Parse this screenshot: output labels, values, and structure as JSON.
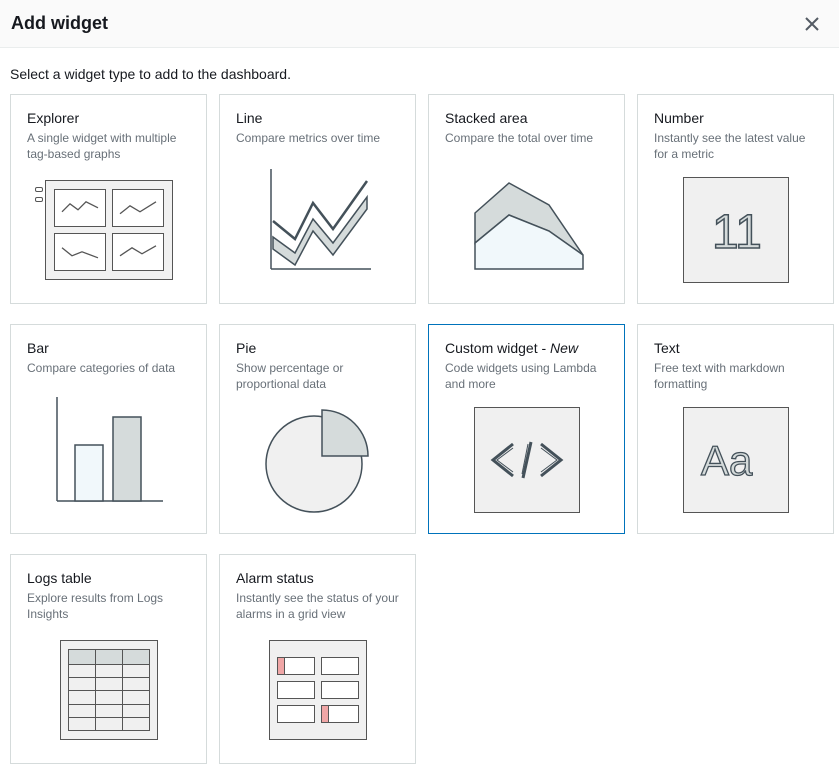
{
  "dialog": {
    "title": "Add widget",
    "subtitle": "Select a widget type to add to the dashboard."
  },
  "widgets": {
    "explorer": {
      "title": "Explorer",
      "desc": "A single widget with multiple tag-based graphs"
    },
    "line": {
      "title": "Line",
      "desc": "Compare metrics over time"
    },
    "stacked": {
      "title": "Stacked area",
      "desc": "Compare the total over time"
    },
    "number": {
      "title": "Number",
      "desc": "Instantly see the latest value for a metric",
      "value": "11"
    },
    "bar": {
      "title": "Bar",
      "desc": "Compare categories of data"
    },
    "pie": {
      "title": "Pie",
      "desc": "Show percentage or proportional data"
    },
    "custom": {
      "title_prefix": "Custom widget - ",
      "title_new": "New",
      "desc": "Code widgets using Lambda and more"
    },
    "text": {
      "title": "Text",
      "desc": "Free text with markdown formatting",
      "sample": "Aa"
    },
    "logs": {
      "title": "Logs table",
      "desc": "Explore results from Logs Insights"
    },
    "alarm": {
      "title": "Alarm status",
      "desc": "Instantly see the status of your alarms in a grid view"
    }
  },
  "selected": "custom"
}
